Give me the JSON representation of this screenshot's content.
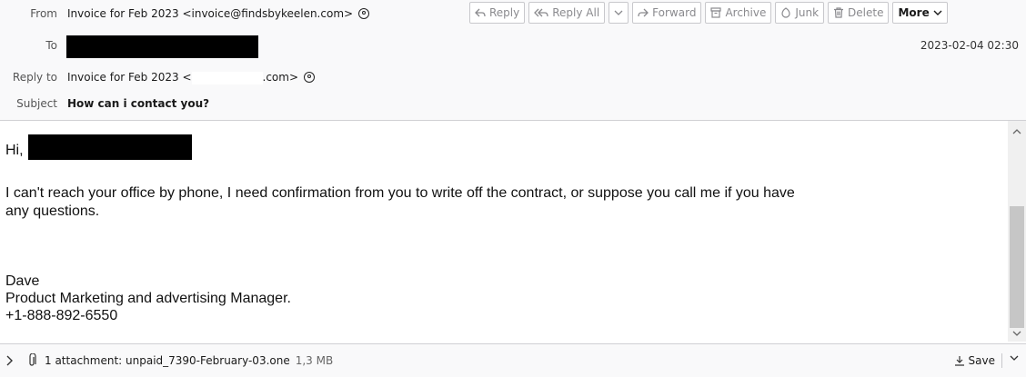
{
  "header": {
    "from_label": "From",
    "from_value": "Invoice for Feb 2023 <invoice@findsbykeelen.com>",
    "to_label": "To",
    "reply_to_label": "Reply to",
    "reply_to_prefix": "Invoice for Feb 2023 <",
    "reply_to_suffix": ".com>",
    "subject_label": "Subject",
    "subject_value": "How can i contact you?",
    "date": "2023-02-04 02:30"
  },
  "toolbar": {
    "reply": "Reply",
    "reply_all": "Reply All",
    "forward": "Forward",
    "archive": "Archive",
    "junk": "Junk",
    "delete": "Delete",
    "more": "More"
  },
  "body": {
    "greeting": "Hi,",
    "paragraph_line1": "I can't reach your office by phone, I need confirmation from you to write off the contract, or suppose you call me if you have",
    "paragraph_line2": "any questions.",
    "signature_name": "Dave",
    "signature_title": "Product Marketing and advertising Manager.",
    "signature_phone": "+1-888-892-6550"
  },
  "attachment": {
    "summary": "1 attachment: unpaid_7390-February-03.one",
    "size": "1,3 MB",
    "save_label": "Save"
  },
  "icons": {
    "contact": "contact-icon",
    "attachment": "paperclip-icon",
    "expand": "chevron-right-icon",
    "save": "download-icon"
  }
}
